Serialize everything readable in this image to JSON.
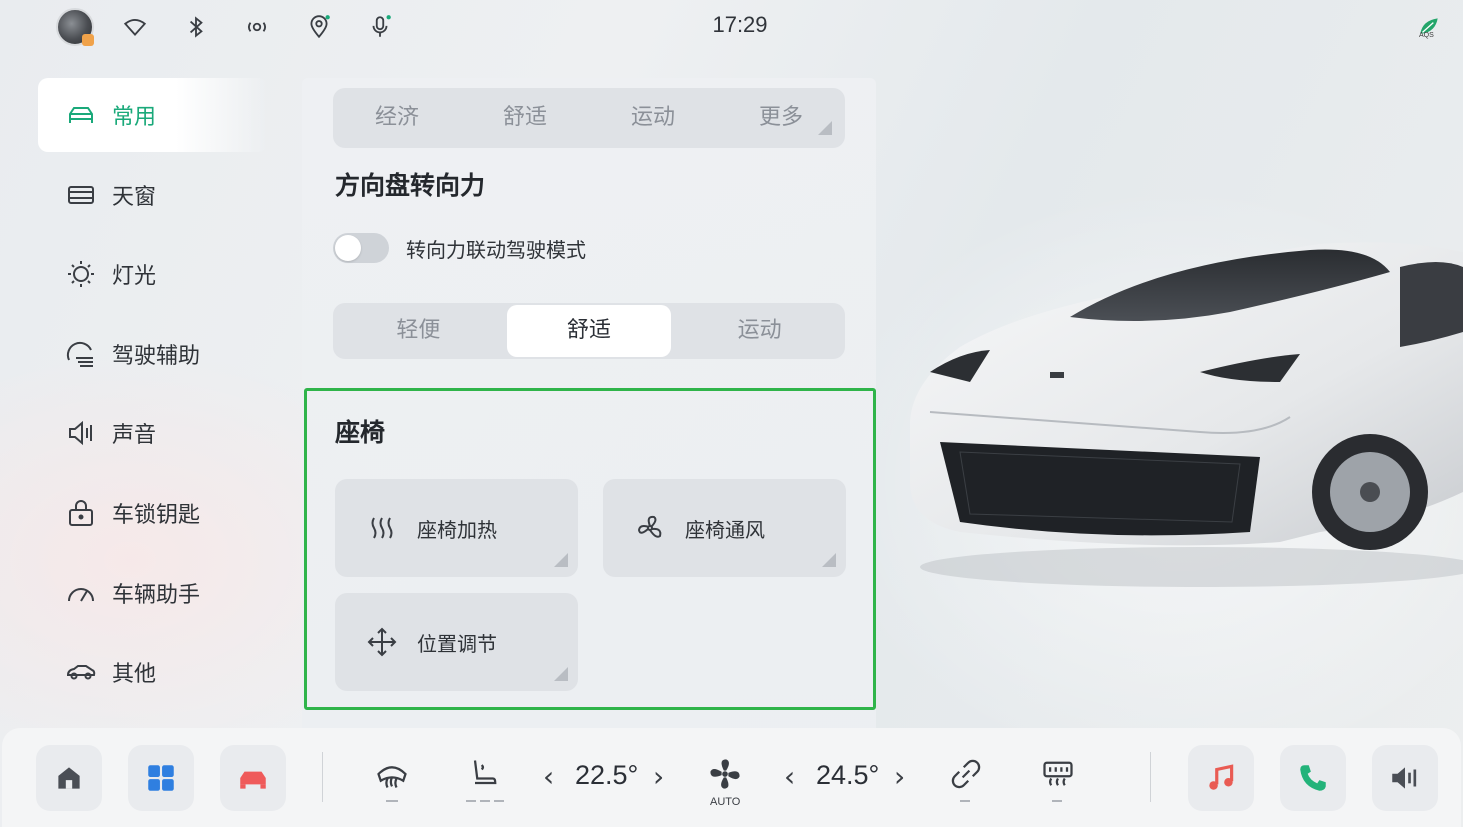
{
  "status_bar": {
    "time": "17:29",
    "icons": [
      "avatar",
      "wifi-icon",
      "bluetooth-icon",
      "hotspot-icon",
      "location-icon",
      "microphone-icon"
    ],
    "aqs_label": "AQS"
  },
  "sidebar": {
    "items": [
      {
        "label": "常用",
        "icon": "car-icon",
        "active": true
      },
      {
        "label": "天窗",
        "icon": "sunroof-icon"
      },
      {
        "label": "灯光",
        "icon": "light-icon"
      },
      {
        "label": "驾驶辅助",
        "icon": "driving-assist-icon"
      },
      {
        "label": "声音",
        "icon": "sound-icon"
      },
      {
        "label": "车锁钥匙",
        "icon": "lock-key-icon"
      },
      {
        "label": "车辆助手",
        "icon": "gauge-icon"
      },
      {
        "label": "其他",
        "icon": "car-outline-icon"
      }
    ]
  },
  "main": {
    "drive_modes": [
      "经济",
      "舒适",
      "运动",
      "更多"
    ],
    "steering": {
      "title": "方向盘转向力",
      "toggle_label": "转向力联动驾驶模式",
      "toggle_on": false,
      "options": [
        "轻便",
        "舒适",
        "运动"
      ],
      "selected": "舒适"
    },
    "seat": {
      "title": "座椅",
      "tiles": [
        {
          "label": "座椅加热",
          "icon": "seat-heat-icon"
        },
        {
          "label": "座椅通风",
          "icon": "fan-icon"
        },
        {
          "label": "位置调节",
          "icon": "move-arrows-icon"
        }
      ]
    }
  },
  "dock": {
    "left_temp": "22.5°",
    "right_temp": "24.5°",
    "fan_label": "AUTO",
    "colors": {
      "accent": "#1aa97a",
      "highlight_border": "#2fb44a",
      "car_red": "#ef5a5a",
      "music_red": "#e95b53",
      "phone_green": "#23b37a",
      "apps_blue": "#2f7fe0"
    }
  }
}
